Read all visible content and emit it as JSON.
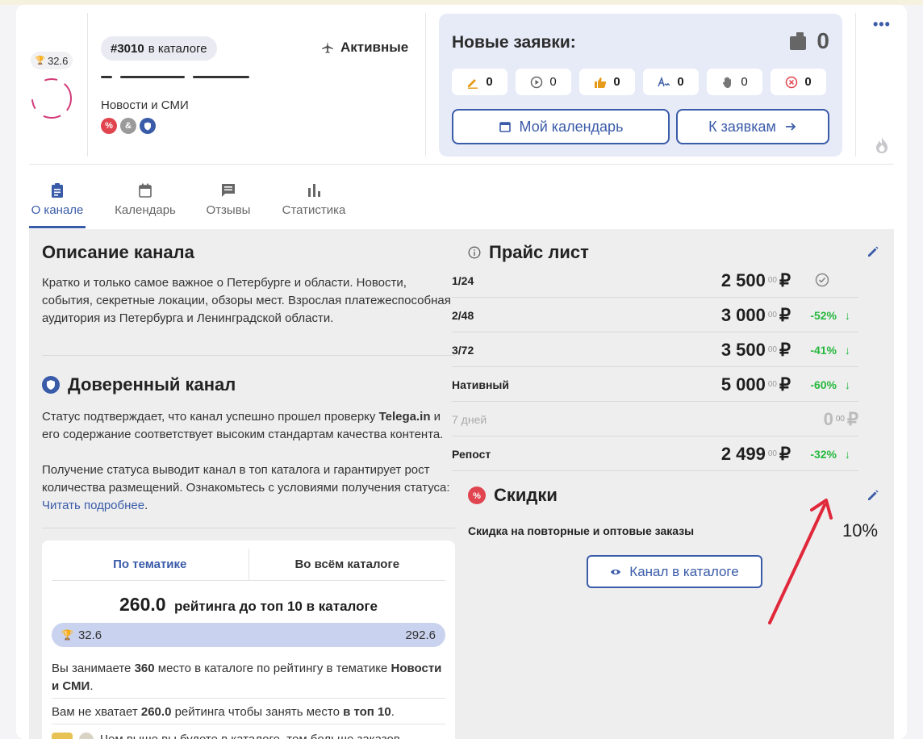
{
  "header": {
    "rating_pill": "32.6",
    "catalog_num": "#3010",
    "catalog_suffix": "в каталоге",
    "status": "Активные",
    "category": "Новости и СМИ",
    "requests": {
      "title": "Новые заявки:",
      "total": "0",
      "chips": [
        {
          "icon": "pencil-icon",
          "count": "0"
        },
        {
          "icon": "play-circle-icon",
          "count": "0"
        },
        {
          "icon": "thumbs-up-icon",
          "count": "0"
        },
        {
          "icon": "signature-icon",
          "count": "0"
        },
        {
          "icon": "hand-icon",
          "count": "0"
        },
        {
          "icon": "cancel-circle-icon",
          "count": "0"
        }
      ],
      "calendar_btn": "Мой календарь",
      "to_requests_btn": "К заявкам"
    }
  },
  "tabs": [
    {
      "label": "О канале",
      "icon": "clipboard-icon",
      "active": true
    },
    {
      "label": "Календарь",
      "icon": "calendar-icon",
      "active": false
    },
    {
      "label": "Отзывы",
      "icon": "comment-icon",
      "active": false
    },
    {
      "label": "Статистика",
      "icon": "bar-chart-icon",
      "active": false
    }
  ],
  "about": {
    "title": "Описание канала",
    "text": "Кратко и только самое важное о Петербурге и области. Новости, события, секретные локации, обзоры мест. Взрослая платежеспособная аудитория из Петербурга и Ленинградской области."
  },
  "trusted": {
    "title": "Доверенный канал",
    "p1_a": "Статус подтверждает, что канал успешно прошел проверку",
    "p1_bold": "Telega.in",
    "p1_b": "и его содержание соответствует высоким стандартам качества контента.",
    "p2": "Получение статуса выводит канал в топ каталога и гарантирует рост количества размещений. Ознакомьтесь с условиями получения статуса:",
    "link": "Читать подробнее",
    "link_end": "."
  },
  "rating": {
    "tab1": "По тематике",
    "tab2": "Во всём каталоге",
    "value": "260.0",
    "value_text": "рейтинга до топ 10 в каталоге",
    "bar_from": "32.6",
    "bar_to": "292.6",
    "bar_fill_fraction": 1.0,
    "line1_a": "Вы занимаете",
    "line1_num": "360",
    "line1_b": "место в каталоге по рейтингу в тематике",
    "line1_cat": "Новости и СМИ",
    "line1_end": ".",
    "line2_a": "Вам не хватает",
    "line2_num": "260.0",
    "line2_b": "рейтинга чтобы занять место",
    "line2_top": "в топ 10",
    "line2_end": ".",
    "line3": "Чем выше вы будете в каталоге, тем больше заказов"
  },
  "price": {
    "title": "Прайс лист",
    "rows": [
      {
        "label": "1/24",
        "value": "2 500",
        "cents": "00",
        "currency": "₽",
        "discount": "",
        "muted": false,
        "check": true
      },
      {
        "label": "2/48",
        "value": "3 000",
        "cents": "00",
        "currency": "₽",
        "discount": "-52%",
        "muted": false,
        "check": false
      },
      {
        "label": "3/72",
        "value": "3 500",
        "cents": "00",
        "currency": "₽",
        "discount": "-41%",
        "muted": false,
        "check": false
      },
      {
        "label": "Нативный",
        "value": "5 000",
        "cents": "00",
        "currency": "₽",
        "discount": "-60%",
        "muted": false,
        "check": false
      },
      {
        "label": "7 дней",
        "value": "0",
        "cents": "00",
        "currency": "₽",
        "discount": "",
        "muted": true,
        "check": false
      },
      {
        "label": "Репост",
        "value": "2 499",
        "cents": "00",
        "currency": "₽",
        "discount": "-32%",
        "muted": false,
        "check": false
      }
    ]
  },
  "discounts": {
    "title": "Скидки",
    "label": "Скидка на повторные и оптовые заказы",
    "value": "10%"
  },
  "catalog_btn": "Канал в каталоге",
  "colors": {
    "accent": "#3a5ba8",
    "discount_green": "#27b83d",
    "arrow_red": "#e0283a"
  }
}
